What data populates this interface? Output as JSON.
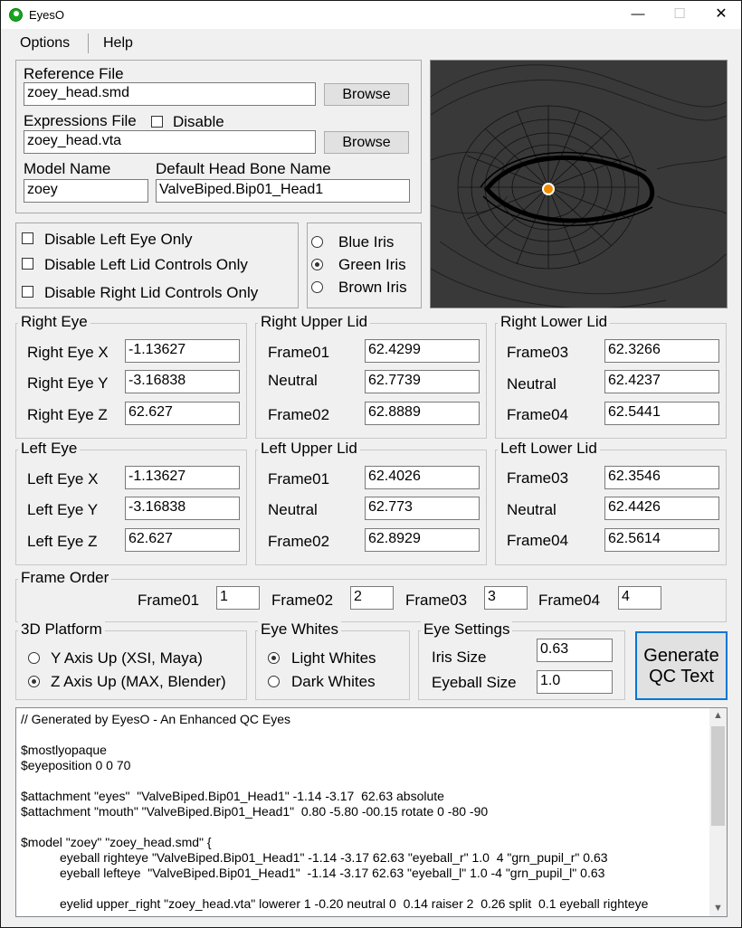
{
  "window": {
    "title": "EyesO",
    "min_glyph": "—",
    "max_glyph": "☐",
    "close_glyph": "✕"
  },
  "menu": [
    "Options",
    "Help"
  ],
  "files": {
    "reference_label": "Reference File",
    "reference_value": "zoey_head.smd",
    "expressions_label": "Expressions File",
    "disable_label": "Disable",
    "expressions_value": "zoey_head.vta",
    "browse_label": "Browse",
    "model_name_label": "Model Name",
    "model_name_value": "zoey",
    "head_bone_label": "Default Head Bone Name",
    "head_bone_value": "ValveBiped.Bip01_Head1"
  },
  "disable_options": [
    "Disable Left Eye Only",
    "Disable Left Lid Controls Only",
    "Disable Right Lid Controls Only"
  ],
  "iris_options": [
    {
      "label": "Blue Iris",
      "checked": false
    },
    {
      "label": "Green Iris",
      "checked": true
    },
    {
      "label": "Brown Iris",
      "checked": false
    }
  ],
  "right_eye": {
    "title": "Right Eye",
    "rows": [
      {
        "label": "Right Eye X",
        "value": "-1.13627"
      },
      {
        "label": "Right Eye Y",
        "value": "-3.16838"
      },
      {
        "label": "Right Eye Z",
        "value": "62.627"
      }
    ]
  },
  "right_upper_lid": {
    "title": "Right Upper Lid",
    "rows": [
      {
        "label": "Frame01",
        "value": "62.4299"
      },
      {
        "label": "Neutral",
        "value": "62.7739"
      },
      {
        "label": "Frame02",
        "value": "62.8889"
      }
    ]
  },
  "right_lower_lid": {
    "title": "Right Lower Lid",
    "rows": [
      {
        "label": "Frame03",
        "value": "62.3266"
      },
      {
        "label": "Neutral",
        "value": "62.4237"
      },
      {
        "label": "Frame04",
        "value": "62.5441"
      }
    ]
  },
  "left_eye": {
    "title": "Left Eye",
    "rows": [
      {
        "label": "Left Eye X",
        "value": "-1.13627"
      },
      {
        "label": "Left Eye Y",
        "value": "-3.16838"
      },
      {
        "label": "Left Eye Z",
        "value": "62.627"
      }
    ]
  },
  "left_upper_lid": {
    "title": "Left Upper Lid",
    "rows": [
      {
        "label": "Frame01",
        "value": "62.4026"
      },
      {
        "label": "Neutral",
        "value": "62.773"
      },
      {
        "label": "Frame02",
        "value": "62.8929"
      }
    ]
  },
  "left_lower_lid": {
    "title": "Left Lower Lid",
    "rows": [
      {
        "label": "Frame03",
        "value": "62.3546"
      },
      {
        "label": "Neutral",
        "value": "62.4426"
      },
      {
        "label": "Frame04",
        "value": "62.5614"
      }
    ]
  },
  "frame_order": {
    "title": "Frame Order",
    "items": [
      {
        "label": "Frame01",
        "value": "1"
      },
      {
        "label": "Frame02",
        "value": "2"
      },
      {
        "label": "Frame03",
        "value": "3"
      },
      {
        "label": "Frame04",
        "value": "4"
      }
    ]
  },
  "platform": {
    "title": "3D Platform",
    "options": [
      {
        "label": "Y Axis Up (XSI, Maya)",
        "checked": false
      },
      {
        "label": "Z Axis Up (MAX, Blender)",
        "checked": true
      }
    ]
  },
  "eye_whites": {
    "title": "Eye Whites",
    "options": [
      {
        "label": "Light Whites",
        "checked": true
      },
      {
        "label": "Dark Whites",
        "checked": false
      }
    ]
  },
  "eye_settings": {
    "title": "Eye Settings",
    "iris_size_label": "Iris Size",
    "iris_size_value": "0.63",
    "eyeball_size_label": "Eyeball Size",
    "eyeball_size_value": "1.0"
  },
  "generate": {
    "line1": "Generate",
    "line2": "QC Text"
  },
  "output_lines": [
    {
      "text": "// Generated by EyesO - An Enhanced QC Eyes",
      "indent": false
    },
    {
      "text": "",
      "indent": false
    },
    {
      "text": "$mostlyopaque",
      "indent": false
    },
    {
      "text": "$eyeposition 0 0 70",
      "indent": false
    },
    {
      "text": "",
      "indent": false
    },
    {
      "text": "$attachment \"eyes\"  \"ValveBiped.Bip01_Head1\" -1.14 -3.17  62.63 absolute",
      "indent": false
    },
    {
      "text": "$attachment \"mouth\" \"ValveBiped.Bip01_Head1\"  0.80 -5.80 -00.15 rotate 0 -80 -90",
      "indent": false
    },
    {
      "text": "",
      "indent": false
    },
    {
      "text": "$model \"zoey\" \"zoey_head.smd\" {",
      "indent": false
    },
    {
      "text": "eyeball righteye \"ValveBiped.Bip01_Head1\" -1.14 -3.17 62.63 \"eyeball_r\" 1.0  4 \"grn_pupil_r\" 0.63",
      "indent": true
    },
    {
      "text": "eyeball lefteye  \"ValveBiped.Bip01_Head1\"  -1.14 -3.17 62.63 \"eyeball_l\" 1.0 -4 \"grn_pupil_l\" 0.63",
      "indent": true
    },
    {
      "text": "",
      "indent": false
    },
    {
      "text": "eyelid upper_right \"zoey_head.vta\" lowerer 1 -0.20 neutral 0  0.14 raiser 2  0.26 split  0.1 eyeball righteye",
      "indent": true
    }
  ],
  "colors": {
    "accent": "#0078d7",
    "preview_bg": "#393939",
    "pupil": "#f08c00",
    "app_icon": "#17a51f"
  },
  "icons": {
    "app": "eye-logo-icon",
    "scroll_up": "▲",
    "scroll_down": "▼"
  }
}
